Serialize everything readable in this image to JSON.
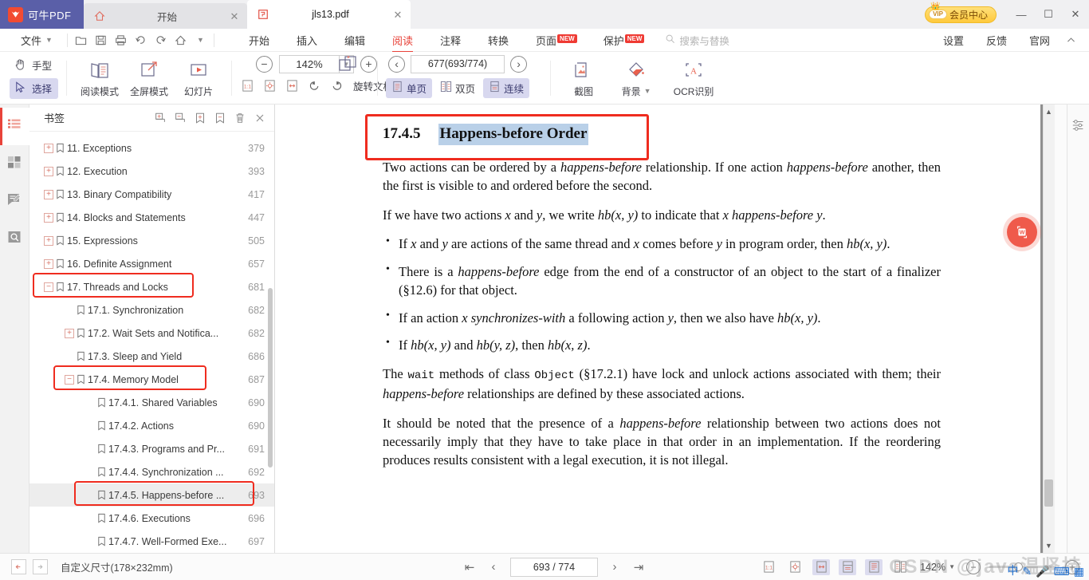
{
  "titlebar": {
    "brand_name": "可牛PDF",
    "tabs": [
      {
        "label": "开始",
        "icon": "home-icon",
        "active": false
      },
      {
        "label": "jls13.pdf",
        "icon": "pdf-file-icon",
        "active": true
      }
    ],
    "vip_label": "会员中心",
    "vip_badge": "VIP",
    "minimize": "—",
    "maximize": "☐",
    "close": "✕"
  },
  "menubar": {
    "file_label": "文件",
    "quick_icons": [
      "open-file-icon",
      "save-icon",
      "print-icon",
      "undo-icon",
      "redo-icon",
      "home-icon",
      "more-caret-icon"
    ],
    "items": [
      {
        "label": "开始",
        "active": false,
        "badge": ""
      },
      {
        "label": "插入",
        "active": false,
        "badge": ""
      },
      {
        "label": "编辑",
        "active": false,
        "badge": ""
      },
      {
        "label": "阅读",
        "active": true,
        "badge": ""
      },
      {
        "label": "注释",
        "active": false,
        "badge": ""
      },
      {
        "label": "转换",
        "active": false,
        "badge": ""
      },
      {
        "label": "页面",
        "active": false,
        "badge": "NEW"
      },
      {
        "label": "保护",
        "active": false,
        "badge": "NEW"
      }
    ],
    "search_placeholder": "搜索与替换",
    "right_items": [
      {
        "label": "设置"
      },
      {
        "label": "反馈"
      },
      {
        "label": "官网"
      }
    ],
    "collapse_icon": "chevron-up-icon"
  },
  "ribbon": {
    "hand_tool": "手型",
    "select_tool": "选择",
    "mode_buttons": [
      {
        "label": "阅读模式",
        "icon": "reading-mode-icon"
      },
      {
        "label": "全屏模式",
        "icon": "fullscreen-mode-icon"
      },
      {
        "label": "幻灯片",
        "icon": "slideshow-icon"
      }
    ],
    "zoom_out": "−",
    "zoom_value": "142%",
    "zoom_in": "+",
    "fit_icons": [
      "actual-size-icon",
      "fit-page-icon",
      "fit-width-icon",
      "rotate-left-icon",
      "rotate-right-icon"
    ],
    "rotate_label": "旋转文档",
    "rotate_icon": "rotate-document-icon",
    "prev_page": "‹",
    "page_field": "677(693/774)",
    "next_page": "›",
    "layout_buttons": [
      {
        "label": "单页",
        "selected": true,
        "icon": "single-page-icon"
      },
      {
        "label": "双页",
        "selected": false,
        "icon": "double-page-icon"
      },
      {
        "label": "连续",
        "selected": true,
        "icon": "continuous-scroll-icon"
      }
    ],
    "right_tools": [
      {
        "label": "截图",
        "icon": "screenshot-icon"
      },
      {
        "label": "背景",
        "icon": "background-icon",
        "caret": true
      },
      {
        "label": "OCR识别",
        "icon": "ocr-icon"
      }
    ]
  },
  "rail": {
    "items": [
      {
        "name": "bookmarks-icon",
        "active": true
      },
      {
        "name": "thumbnails-icon",
        "active": false
      },
      {
        "name": "annotations-icon",
        "active": false
      },
      {
        "name": "search-icon",
        "active": false
      }
    ]
  },
  "bookmarks": {
    "title": "书签",
    "tools": [
      "add-child-bookmark-icon",
      "remove-child-bookmark-icon",
      "add-bookmark-icon",
      "remove-bookmark-icon",
      "delete-icon",
      "close-icon"
    ],
    "items": [
      {
        "label": "11. Exceptions",
        "page": "379",
        "indent": 0,
        "toggle": "+"
      },
      {
        "label": "12. Execution",
        "page": "393",
        "indent": 0,
        "toggle": "+"
      },
      {
        "label": "13. Binary Compatibility",
        "page": "417",
        "indent": 0,
        "toggle": "+"
      },
      {
        "label": "14. Blocks and Statements",
        "page": "447",
        "indent": 0,
        "toggle": "+"
      },
      {
        "label": "15. Expressions",
        "page": "505",
        "indent": 0,
        "toggle": "+"
      },
      {
        "label": "16. Definite Assignment",
        "page": "657",
        "indent": 0,
        "toggle": "+"
      },
      {
        "label": "17. Threads and Locks",
        "page": "681",
        "indent": 0,
        "toggle": "−",
        "highlight": true
      },
      {
        "label": "17.1. Synchronization",
        "page": "682",
        "indent": 1,
        "toggle": ""
      },
      {
        "label": "17.2. Wait Sets and Notifica...",
        "page": "682",
        "indent": 1,
        "toggle": "+"
      },
      {
        "label": "17.3. Sleep and Yield",
        "page": "686",
        "indent": 1,
        "toggle": ""
      },
      {
        "label": "17.4. Memory Model",
        "page": "687",
        "indent": 1,
        "toggle": "−",
        "highlight": true
      },
      {
        "label": "17.4.1. Shared Variables",
        "page": "690",
        "indent": 2,
        "toggle": ""
      },
      {
        "label": "17.4.2. Actions",
        "page": "690",
        "indent": 2,
        "toggle": ""
      },
      {
        "label": "17.4.3. Programs and Pr...",
        "page": "691",
        "indent": 2,
        "toggle": ""
      },
      {
        "label": "17.4.4. Synchronization ...",
        "page": "692",
        "indent": 2,
        "toggle": ""
      },
      {
        "label": "17.4.5. Happens-before ...",
        "page": "693",
        "indent": 2,
        "toggle": "",
        "highlight": true,
        "selected": true
      },
      {
        "label": "17.4.6. Executions",
        "page": "696",
        "indent": 2,
        "toggle": ""
      },
      {
        "label": "17.4.7. Well-Formed Exe...",
        "page": "697",
        "indent": 2,
        "toggle": ""
      }
    ]
  },
  "document": {
    "section_number": "17.4.5",
    "section_title": "Happens-before Order",
    "para1_a": "Two actions can be ordered by a ",
    "para1_i1": "happens-before",
    "para1_b": " relationship. If one action ",
    "para1_i2": "happens-before",
    "para1_c": " another, then the first is visible to and ordered before the second.",
    "para2_a": "If we have two actions ",
    "para2_x": "x",
    "para2_b": " and ",
    "para2_y": "y",
    "para2_c": ", we write ",
    "para2_hb": "hb(x, y)",
    "para2_d": " to indicate that ",
    "para2_x2": "x",
    "para2_e": " ",
    "para2_hbi": "happens-before",
    "para2_f": " ",
    "para2_y2": "y",
    "para2_g": ".",
    "bullets": [
      {
        "parts": [
          {
            "t": "If ",
            "s": "n"
          },
          {
            "t": "x",
            "s": "i"
          },
          {
            "t": " and ",
            "s": "n"
          },
          {
            "t": "y",
            "s": "i"
          },
          {
            "t": " are actions of the same thread and ",
            "s": "n"
          },
          {
            "t": "x",
            "s": "i"
          },
          {
            "t": " comes before ",
            "s": "n"
          },
          {
            "t": "y",
            "s": "i"
          },
          {
            "t": " in program order, then ",
            "s": "n"
          },
          {
            "t": "hb(x, y)",
            "s": "i"
          },
          {
            "t": ".",
            "s": "n"
          }
        ]
      },
      {
        "parts": [
          {
            "t": "There is a ",
            "s": "n"
          },
          {
            "t": "happens-before",
            "s": "i"
          },
          {
            "t": " edge from the end of a constructor of an object to the start of a finalizer (§12.6) for that object.",
            "s": "n"
          }
        ]
      },
      {
        "parts": [
          {
            "t": "If an action ",
            "s": "n"
          },
          {
            "t": "x",
            "s": "i"
          },
          {
            "t": " ",
            "s": "n"
          },
          {
            "t": "synchronizes-with",
            "s": "i"
          },
          {
            "t": " a following action ",
            "s": "n"
          },
          {
            "t": "y",
            "s": "i"
          },
          {
            "t": ", then we also have ",
            "s": "n"
          },
          {
            "t": "hb(x, y)",
            "s": "i"
          },
          {
            "t": ".",
            "s": "n"
          }
        ]
      },
      {
        "parts": [
          {
            "t": "If ",
            "s": "n"
          },
          {
            "t": "hb(x, y)",
            "s": "i"
          },
          {
            "t": " and ",
            "s": "n"
          },
          {
            "t": "hb(y, z)",
            "s": "i"
          },
          {
            "t": ", then ",
            "s": "n"
          },
          {
            "t": "hb(x, z)",
            "s": "i"
          },
          {
            "t": ".",
            "s": "n"
          }
        ]
      }
    ],
    "para3_a": "The ",
    "para3_wait": "wait",
    "para3_b": " methods of class ",
    "para3_object": "Object",
    "para3_c": " (§17.2.1) have lock and unlock actions associated with them; their ",
    "para3_i": "happens-before",
    "para3_d": " relationships are defined by these associated actions.",
    "para4_a": "It should be noted that the presence of a ",
    "para4_i": "happens-before",
    "para4_b": " relationship between two actions does not necessarily imply that they have to take place in that order in an implementation. If the reordering produces results consistent with a legal execution, it is not illegal."
  },
  "statusbar": {
    "page_size": "自定义尺寸(178×232mm)",
    "first_page": "first-page-icon",
    "prev_page": "prev-page-icon",
    "page_field": "693 / 774",
    "next_page": "next-page-icon",
    "last_page": "last-page-icon",
    "view_buttons": [
      {
        "name": "actual-size-icon",
        "selected": false
      },
      {
        "name": "fit-page-icon",
        "selected": false
      },
      {
        "name": "fit-width-icon",
        "selected": true
      },
      {
        "name": "continuous-view-icon",
        "selected": true
      },
      {
        "name": "single-page-view-icon",
        "selected": true
      },
      {
        "name": "double-page-view-icon",
        "selected": false
      }
    ],
    "zoom_value": "142%",
    "zoom_out": "−",
    "zoom_in": "+"
  },
  "watermark": {
    "text": "CSDN @java温坚持"
  },
  "colors": {
    "brand_purple": "#5a5fa8",
    "accent_red": "#e8433a",
    "highlight_blue": "#b9d0e8",
    "annotation_red": "#ef2c1f",
    "vip_gold": "#ffc93c",
    "selection_lavender": "#d8d8ef"
  }
}
